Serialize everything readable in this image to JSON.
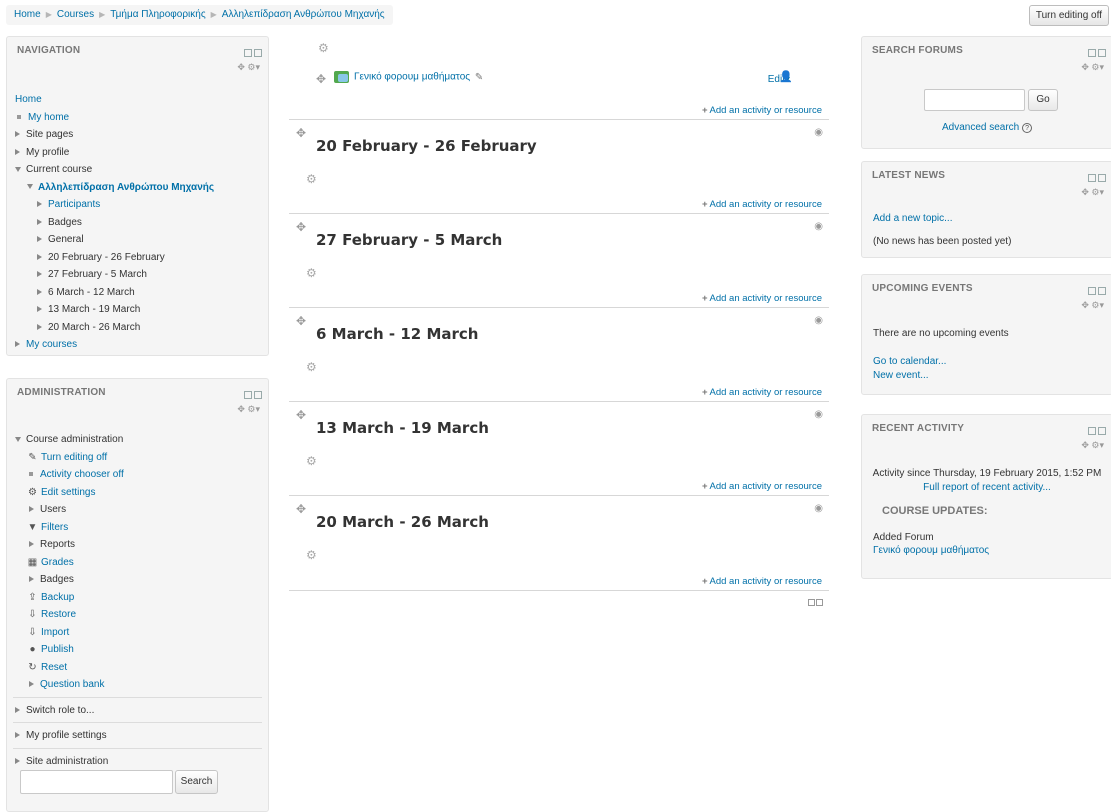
{
  "breadcrumb": [
    "Home",
    "Courses",
    "Τμήμα Πληροφορικής",
    "Αλληλεπίδραση Ανθρώπου Μηχανής"
  ],
  "turn_editing_button": "Turn editing off",
  "navigation": {
    "title": "NAVIGATION",
    "home": "Home",
    "my_home": "My home",
    "site_pages": "Site pages",
    "my_profile": "My profile",
    "current_course": "Current course",
    "course_name": "Αλληλεπίδραση Ανθρώπου Μηχανής",
    "participants": "Participants",
    "badges": "Badges",
    "general": "General",
    "weeks": [
      "20 February - 26 February",
      "27 February - 5 March",
      "6 March - 12 March",
      "13 March - 19 March",
      "20 March - 26 March"
    ],
    "my_courses": "My courses"
  },
  "administration": {
    "title": "ADMINISTRATION",
    "course_admin": "Course administration",
    "items": [
      "Turn editing off",
      "Activity chooser off",
      "Edit settings",
      "Users",
      "Filters",
      "Reports",
      "Grades",
      "Badges",
      "Backup",
      "Restore",
      "Import",
      "Publish",
      "Reset",
      "Question bank"
    ],
    "switch_role": "Switch role to...",
    "my_profile_settings": "My profile settings",
    "site_admin": "Site administration",
    "search_button": "Search"
  },
  "main": {
    "forum_name": "Γενικό φορουμ μαθήματος",
    "edit_label": "Edit",
    "add_activity": "Add an activity or resource",
    "sections": [
      "20 February - 26 February",
      "27 February - 5 March",
      "6 March - 12 March",
      "13 March - 19 March",
      "20 March - 26 March"
    ]
  },
  "search_forums": {
    "title": "SEARCH FORUMS",
    "go": "Go",
    "advanced": "Advanced search"
  },
  "latest_news": {
    "title": "LATEST NEWS",
    "add_topic": "Add a new topic...",
    "empty": "(No news has been posted yet)"
  },
  "upcoming_events": {
    "title": "UPCOMING EVENTS",
    "empty": "There are no upcoming events",
    "calendar": "Go to calendar...",
    "new_event": "New event..."
  },
  "recent_activity": {
    "title": "RECENT ACTIVITY",
    "since": "Activity since Thursday, 19 February 2015, 1:52 PM",
    "full_report": "Full report of recent activity...",
    "updates_title": "COURSE UPDATES:",
    "added": "Added Forum",
    "forum": "Γενικό φορουμ μαθήματος"
  }
}
